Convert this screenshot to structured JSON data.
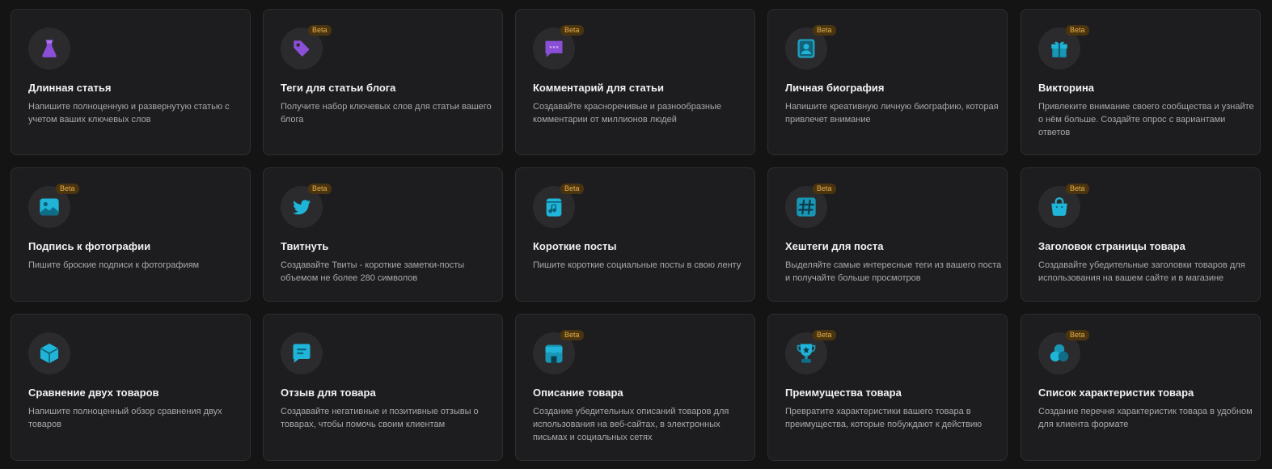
{
  "badge_label": "Beta",
  "colors": {
    "background": "#141414",
    "card": "#1d1d1f",
    "badge_bg": "#4a3410",
    "badge_text": "#e6b04a",
    "icon_cyan": "#1fb4d8",
    "icon_purple": "#8a4fd6"
  },
  "cards": [
    {
      "title": "Длинная статья",
      "desc": "Напишите полноценную и развернутую статью с учетом ваших ключевых слов",
      "beta": false,
      "icon": "flask-icon"
    },
    {
      "title": "Теги для статьи блога",
      "desc": "Получите набор ключевых слов для статьи вашего блога",
      "beta": true,
      "icon": "tag-icon"
    },
    {
      "title": "Комментарий для статьи",
      "desc": "Создавайте красноречивые и разнообразные комментарии от миллионов людей",
      "beta": true,
      "icon": "chat-dots-icon"
    },
    {
      "title": "Личная биография",
      "desc": "Напишите креативную личную биографию, которая привлечет внимание",
      "beta": true,
      "icon": "user-card-icon"
    },
    {
      "title": "Викторина",
      "desc": "Привлеките внимание своего сообщества и узнайте о нём больше. Создайте опрос с вариантами ответов",
      "beta": true,
      "icon": "gift-icon"
    },
    {
      "title": "Подпись к фотографии",
      "desc": "Пишите броские подписи к фотографиям",
      "beta": true,
      "icon": "image-icon"
    },
    {
      "title": "Твитнуть",
      "desc": "Создавайте Твиты - короткие заметки-посты объемом не более 280 символов",
      "beta": true,
      "icon": "twitter-icon"
    },
    {
      "title": "Короткие посты",
      "desc": "Пишите короткие социальные посты в свою ленту",
      "beta": true,
      "icon": "music-note-icon"
    },
    {
      "title": "Хештеги для поста",
      "desc": "Выделяйте самые интересные теги из вашего поста и получайте больше просмотров",
      "beta": true,
      "icon": "hashtag-icon"
    },
    {
      "title": "Заголовок страницы товара",
      "desc": "Создавайте убедительные заголовки товаров для использования на вашем сайте и в магазине",
      "beta": true,
      "icon": "shopping-bag-icon"
    },
    {
      "title": "Сравнение двух товаров",
      "desc": "Напишите полноценный обзор сравнения двух товаров",
      "beta": false,
      "icon": "cube-icon"
    },
    {
      "title": "Отзыв для товара",
      "desc": "Создавайте негативные и позитивные отзывы о товарах, чтобы помочь своим клиентам",
      "beta": false,
      "icon": "message-icon"
    },
    {
      "title": "Описание товара",
      "desc": "Создание убедительных описаний товаров для использования на веб-сайтах, в электронных письмах и социальных сетях",
      "beta": true,
      "icon": "store-icon"
    },
    {
      "title": "Преимущества товара",
      "desc": "Превратите характеристики вашего товара в преимущества, которые побуждают к действию",
      "beta": true,
      "icon": "trophy-icon"
    },
    {
      "title": "Список характеристик товара",
      "desc": "Создание перечня характеристик товара в удобном для клиента формате",
      "beta": true,
      "icon": "circles-icon"
    }
  ]
}
